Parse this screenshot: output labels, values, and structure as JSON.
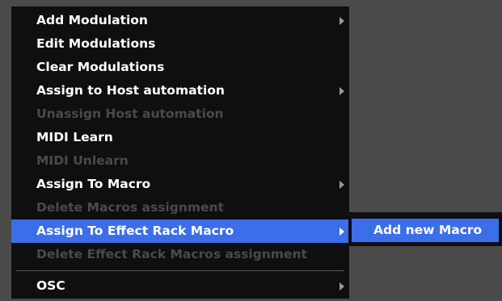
{
  "context_menu": {
    "items": [
      {
        "label": "Add Modulation",
        "enabled": true,
        "has_submenu": true
      },
      {
        "label": "Edit Modulations",
        "enabled": true,
        "has_submenu": false
      },
      {
        "label": "Clear Modulations",
        "enabled": true,
        "has_submenu": false
      },
      {
        "label": "Assign to Host automation",
        "enabled": true,
        "has_submenu": true
      },
      {
        "label": "Unassign Host automation",
        "enabled": false,
        "has_submenu": false
      },
      {
        "label": "MIDI Learn",
        "enabled": true,
        "has_submenu": false
      },
      {
        "label": "MIDI Unlearn",
        "enabled": false,
        "has_submenu": false
      },
      {
        "label": "Assign To Macro",
        "enabled": true,
        "has_submenu": true
      },
      {
        "label": "Delete Macros assignment",
        "enabled": false,
        "has_submenu": false
      },
      {
        "label": "Assign To Effect Rack Macro",
        "enabled": true,
        "has_submenu": true,
        "highlighted": true
      },
      {
        "label": "Delete Effect Rack Macros assignment",
        "enabled": false,
        "has_submenu": false
      },
      {
        "label": "OSC",
        "enabled": true,
        "has_submenu": true
      }
    ]
  },
  "submenu": {
    "items": [
      {
        "label": "Add new Macro",
        "highlighted": true
      }
    ]
  },
  "colors": {
    "background": "#4a4a4a",
    "menu_background": "#0f0f0f",
    "highlight": "#3c6eea",
    "enabled_text": "#ffffff",
    "disabled_text": "#4a4a4a"
  },
  "icons": {
    "submenu_arrow": "chevron-right-icon"
  }
}
